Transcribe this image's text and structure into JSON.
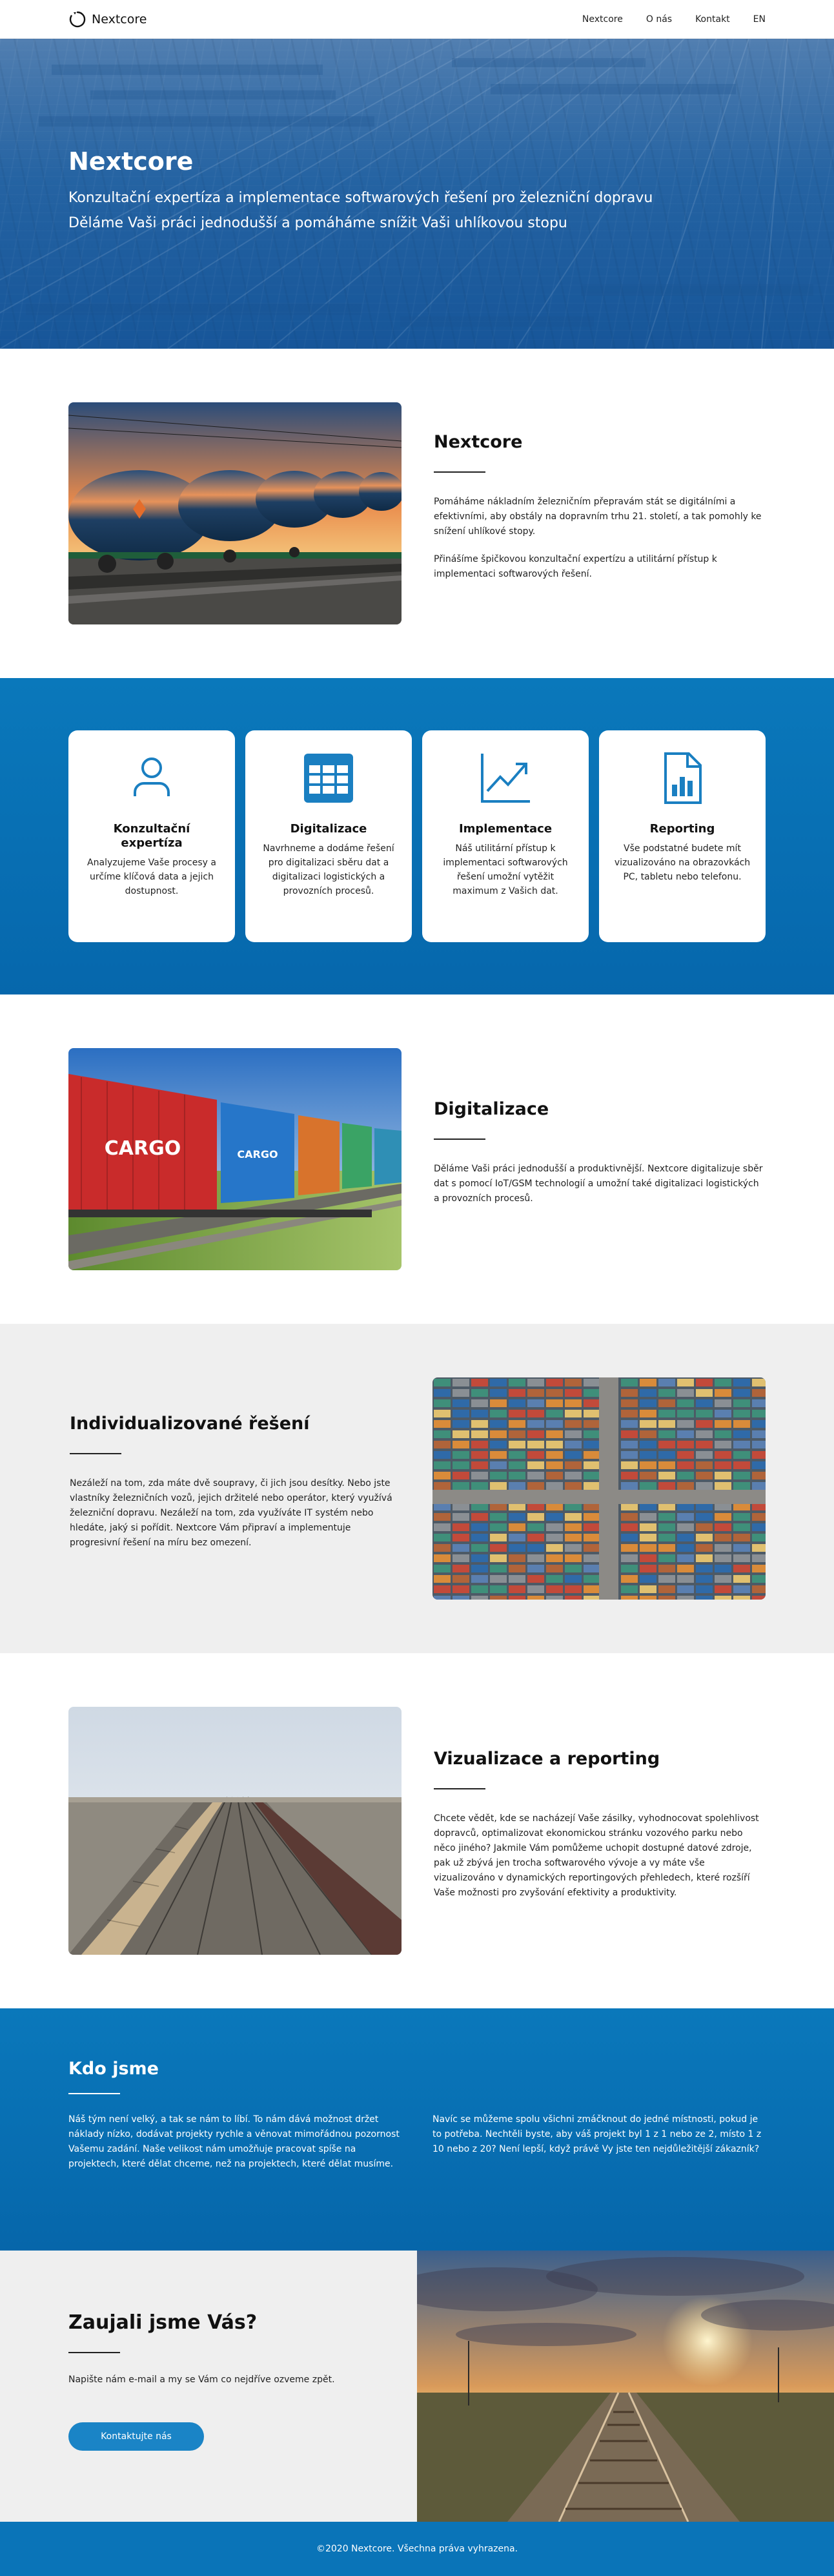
{
  "nav": {
    "brand": "Nextcore",
    "links": [
      "Nextcore",
      "O nás",
      "Kontakt",
      "EN"
    ]
  },
  "hero": {
    "title": "Nextcore",
    "subtitle_1": "Konzultační expertíza a implementace softwarových řešení pro železniční dopravu",
    "subtitle_2": "Děláme Vaši práci jednodušší a pomáháme snížit Vaši uhlíkovou stopu"
  },
  "intro": {
    "title": "Nextcore",
    "paragraphs": [
      "Pomáháme nákladním železničním přepravám stát se digitálními a efektivními, aby obstály na dopravním trhu 21. století, a tak pomohly ke snížení uhlíkové stopy.",
      "Přinášíme špičkovou konzultační expertízu a utilitární přístup k implementaci softwarových řešení."
    ]
  },
  "services": [
    {
      "icon": "user-icon",
      "title": "Konzultační expertíza",
      "text": "Analyzujeme Vaše procesy a určíme klíčová data a jejich dostupnost."
    },
    {
      "icon": "table-icon",
      "title": "Digitalizace",
      "text": "Navrhneme a dodáme řešení pro digitalizaci sběru dat a digitalizaci logistických a provozních procesů."
    },
    {
      "icon": "trend-chart-icon",
      "title": "Implementace",
      "text": "Náš utilitární přístup k implementaci softwarových řešení umožní vytěžit maximum z Vašich dat."
    },
    {
      "icon": "report-document-icon",
      "title": "Reporting",
      "text": "Vše podstatné budete mít vizualizováno na obrazovkách PC, tabletu nebo telefonu."
    }
  ],
  "digitalization": {
    "title": "Digitalizace",
    "paragraph": "Děláme Vaši práci jednodušší a produktivnější. Nextcore digitalizuje sběr dat s pomocí IoT/GSM technologií a umožní také digitalizaci logistických a provozních procesů.",
    "image_text": "CARGO"
  },
  "individual": {
    "title": "Individualizované řešení",
    "paragraph": "Nezáleží na tom, zda máte dvě soupravy, či jich jsou desítky. Nebo jste vlastníky železničních vozů, jejich držitelé nebo operátor, který využívá železniční dopravu. Nezáleží na tom, zda využíváte IT systém nebo hledáte, jaký si pořídit. Nextcore Vám připraví a implementuje progresivní řešení na míru bez omezení."
  },
  "visualization": {
    "title": "Vizualizace a reporting",
    "paragraph": "Chcete vědět, kde se nacházejí Vaše zásilky, vyhodnocovat spolehlivost dopravců, optimalizovat ekonomickou stránku vozového parku nebo něco jiného? Jakmile Vám pomůžeme uchopit dostupné datové zdroje, pak už zbývá jen trocha softwarového vývoje a vy máte vše vizualizováno v dynamických reportingových přehledech, které rozšíří Vaše možnosti pro zvyšování efektivity a produktivity."
  },
  "about": {
    "title": "Kdo jsme",
    "col_1": "Náš tým není velký, a tak se nám to líbí. To nám dává možnost držet náklady nízko, dodávat projekty rychle a věnovat mimořádnou pozornost Vašemu zadání. Naše velikost nám umožňuje pracovat spíše na projektech, které dělat chceme, než na projektech, které dělat musíme.",
    "col_2": "Navíc se můžeme spolu všichni zmáčknout do jedné místnosti, pokud je to potřeba. Nechtěli byste, aby váš projekt byl 1 z 1 nebo ze 2, místo 1 z 10 nebo z 20? Není lepší, když právě Vy jste ten nejdůležitější zákazník?"
  },
  "contact": {
    "title": "Zaujali jsme Vás?",
    "text": "Napište nám e-mail a my se Vám co nejdříve ozveme zpět.",
    "button": "Kontaktujte nás"
  },
  "footer": {
    "text": "©2020 Nextcore. Všechna práva vyhrazena."
  },
  "colors": {
    "primary_blue": "#0a78bb",
    "button_blue": "#1a84c6",
    "light_gray": "#efefef"
  }
}
